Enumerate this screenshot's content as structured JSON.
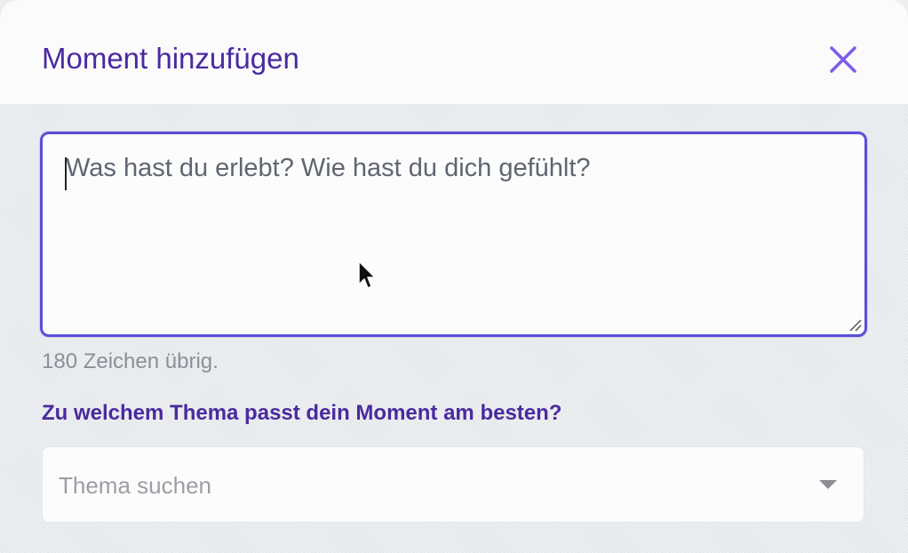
{
  "modal": {
    "title": "Moment hinzufügen",
    "close_icon": "close-icon"
  },
  "moment_input": {
    "placeholder": "Was hast du erlebt? Wie hast du dich gefühlt?",
    "value": "",
    "remaining_text": "180 Zeichen übrig."
  },
  "topic": {
    "question": "Zu welchem Thema passt dein Moment am besten?",
    "search_placeholder": "Thema suchen",
    "dropdown_icon": "chevron-down-icon"
  },
  "colors": {
    "accent": "#4a2aa0",
    "focus_border": "#5b4fd8",
    "close_icon": "#7c5ce8",
    "muted_text": "#8a909a"
  }
}
